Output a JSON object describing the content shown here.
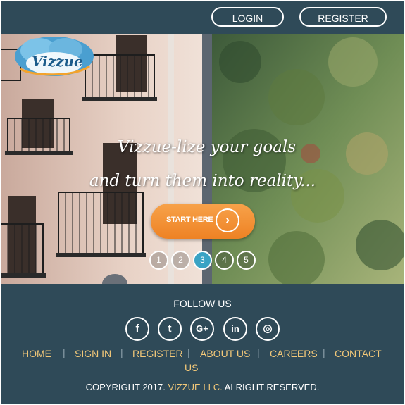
{
  "header": {
    "logo_text": "Vizzue",
    "login_label": "LOGIN",
    "register_label": "REGISTER"
  },
  "hero": {
    "headline_line1": "Vizzue-lize your goals",
    "headline_line2": "and turn them into reality...",
    "cta_label": "START HERE",
    "cta_icon": "chevron-right-icon",
    "slides": [
      "1",
      "2",
      "3",
      "4",
      "5"
    ],
    "active_slide": "3"
  },
  "footer": {
    "follow_label": "FOLLOW US",
    "social": [
      {
        "icon": "facebook-icon",
        "glyph": "f"
      },
      {
        "icon": "twitter-icon",
        "glyph": "t"
      },
      {
        "icon": "google-plus-icon",
        "glyph": "G+"
      },
      {
        "icon": "linkedin-icon",
        "glyph": "in"
      },
      {
        "icon": "instagram-icon",
        "glyph": "◎"
      }
    ],
    "nav": {
      "home": "HOME",
      "sign_in": "SIGN IN",
      "register": "REGISTER",
      "about": "ABOUT US",
      "careers": "CAREERS",
      "contact_line1": "CONTACT",
      "contact_line2": "US"
    },
    "copyright_prefix": "COPYRIGHT 2017.",
    "copyright_company": "VIZZUE LLC.",
    "copyright_suffix": "ALRIGHT RESERVED."
  },
  "colors": {
    "bar": "#2f4a58",
    "accent": "#ee8224",
    "link": "#f2c879",
    "active_dot": "#3aa3c4"
  }
}
